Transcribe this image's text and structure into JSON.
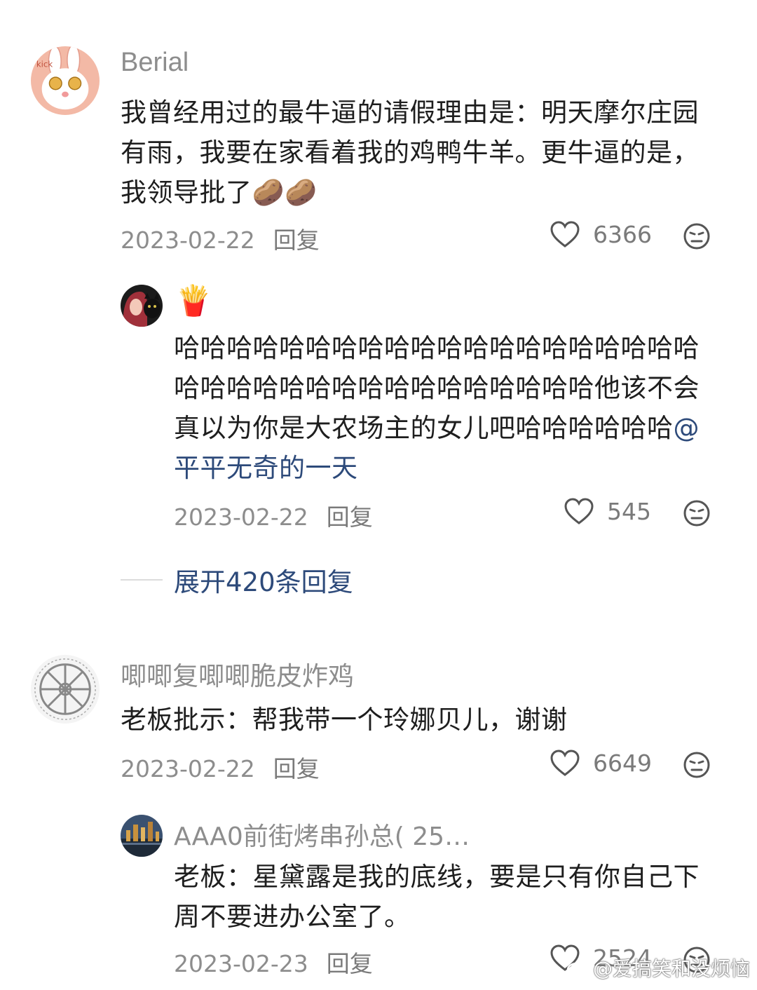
{
  "comments": [
    {
      "username": "Berial",
      "avatar": "rabbit-avatar",
      "text": "我曾经用过的最牛逼的请假理由是：明天摩尔庄园有雨，我要在家看着我的鸡鸭牛羊。更牛逼的是，我领导批了",
      "emoji": "🥔🥔",
      "date": "2023-02-22",
      "reply_label": "回复",
      "likes": "6366",
      "reply": {
        "username": "🍟",
        "avatar": "girl-cat-avatar",
        "text": "哈哈哈哈哈哈哈哈哈哈哈哈哈哈哈哈哈哈哈哈哈哈哈哈哈哈哈哈哈哈哈哈哈哈哈哈他该不会真以为你是大农场主的女儿吧哈哈哈哈哈哈",
        "mention": "@平平无奇的一天",
        "date": "2023-02-22",
        "reply_label": "回复",
        "likes": "545"
      },
      "expand_label": "展开420条回复"
    },
    {
      "username": "唧唧复唧唧脆皮炸鸡",
      "avatar": "wheel-avatar",
      "text": "老板批示：帮我带一个玲娜贝儿，谢谢",
      "date": "2023-02-22",
      "reply_label": "回复",
      "likes": "6649",
      "reply": {
        "username": "AAA0前街烤串孙总( 25…",
        "avatar": "city-avatar",
        "text": "老板：星黛露是我的底线，要是只有你自己下周不要进办公室了。",
        "date": "2023-02-23",
        "reply_label": "回复",
        "likes": "2524"
      }
    }
  ],
  "watermark": "@爱搞笑和没烦恼",
  "colors": {
    "mention": "#2d4a7a",
    "meta": "#8d8d8d"
  }
}
